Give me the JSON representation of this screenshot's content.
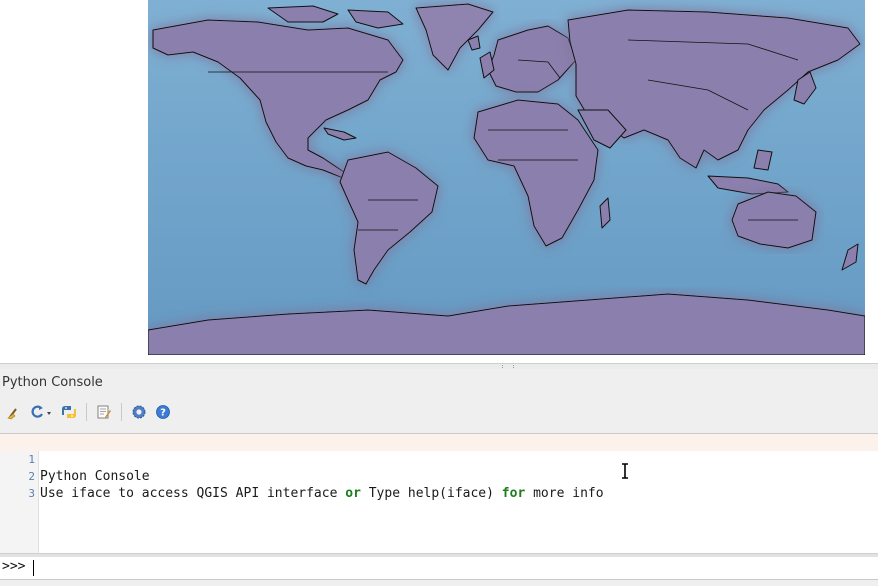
{
  "app": "QGIS",
  "map": {
    "ocean_color": "#6fa3c9",
    "land_color": "#8b80ad",
    "border_color": "#111111"
  },
  "console": {
    "title": "Python Console",
    "toolbar": [
      {
        "name": "clear-console",
        "icon": "broom-icon"
      },
      {
        "name": "import-class",
        "icon": "refresh-dropdown-icon"
      },
      {
        "name": "run-command",
        "icon": "python-icon"
      },
      {
        "name": "show-editor",
        "icon": "editor-icon"
      },
      {
        "name": "settings",
        "icon": "gear-icon"
      },
      {
        "name": "help",
        "icon": "help-icon"
      }
    ],
    "lines": [
      {
        "number": "1",
        "text": "Python Console"
      },
      {
        "number": "2",
        "parts": [
          "Use iface to access QGIS API interface ",
          "or",
          " Type help(iface) ",
          "for",
          " more info"
        ]
      },
      {
        "number": "3",
        "text": ""
      }
    ],
    "prompt": ">>>"
  }
}
